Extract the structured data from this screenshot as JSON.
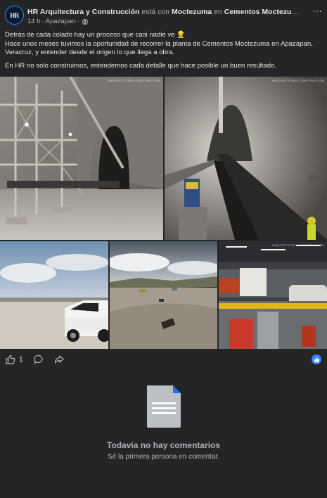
{
  "post": {
    "author": "HR Arquitectura y Construcción",
    "with_text": "está con",
    "tagged": "Moctezuma",
    "in_text": "en",
    "location": "Cementos Moctezuma, Plant...",
    "time": "14 h",
    "separator": "·",
    "place": "Apazapan",
    "dot": "·",
    "more_icon": "···",
    "avatar_initials": "HR",
    "paragraph1_line1": "Detrás de cada colado hay un proceso que casi nadie ve 👷",
    "paragraph1_rest": "Hace unos meses tuvimos la oportunidad de recorrer la planta de Cementos Moctezuma en Apazapan, Veracruz, y entender desde el origen lo que llega a obra.",
    "paragraph2": "En HR no solo construimos, entendemos cada detalle que hace posible un buen resultado.",
    "watermark": "ARQUITECTURA & CONSTRUCCIÓN"
  },
  "actions": {
    "like_count": "1",
    "like_icon": "thumbs-up-icon",
    "comment_icon": "comment-icon",
    "share_icon": "share-icon",
    "reaction_icon": "like-reaction-icon"
  },
  "comments": {
    "empty_title": "Todavía no hay comentarios",
    "empty_subtitle": "Sé la primera persona en comentar.",
    "icon": "document-icon"
  },
  "colors": {
    "background": "#242526",
    "text_primary": "#e4e6eb",
    "text_secondary": "#b0b3b8",
    "accent": "#2d88ff"
  }
}
